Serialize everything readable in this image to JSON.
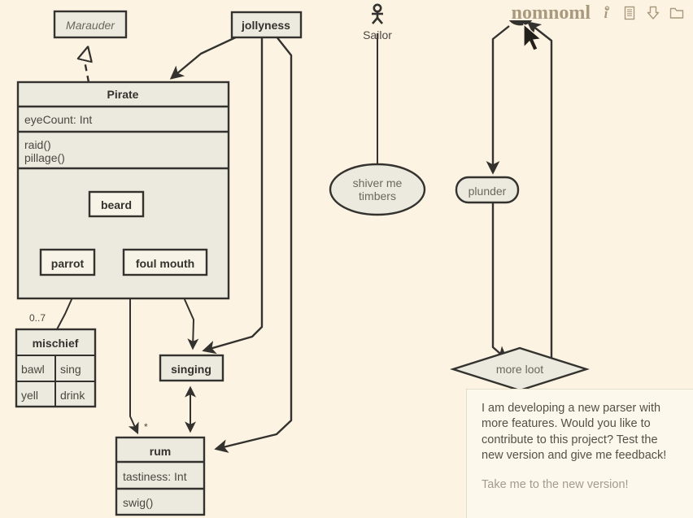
{
  "header": {
    "brand": "nomnoml",
    "icons": [
      {
        "name": "info-icon",
        "label": "i"
      },
      {
        "name": "document-icon",
        "label": "document"
      },
      {
        "name": "download-icon",
        "label": "download"
      },
      {
        "name": "open-folder-icon",
        "label": "open folder"
      }
    ]
  },
  "notice": {
    "message": "I am developing a new parser with more features. Would you like to contribute to this project? Test the new version and give me feedback!",
    "link": "Take me to the new version!"
  },
  "diagram": {
    "nodes": {
      "marauder": {
        "title": "Marauder",
        "style": "abstract"
      },
      "jollyness": {
        "title": "jollyness",
        "style": "class"
      },
      "pirate": {
        "title": "Pirate",
        "attributes": "eyeCount: Int",
        "methods_line1": "raid()",
        "methods_line2": "pillage()"
      },
      "beard": {
        "title": "beard"
      },
      "parrot": {
        "title": "parrot"
      },
      "foul_mouth": {
        "title": "foul mouth"
      },
      "mischief": {
        "title": "mischief",
        "rows": [
          [
            "bawl",
            "sing"
          ],
          [
            "yell",
            "drink"
          ]
        ]
      },
      "singing": {
        "title": "singing"
      },
      "rum": {
        "title": "rum",
        "attributes": "tastiness: Int",
        "methods": "swig()"
      },
      "sailor": {
        "title": "Sailor",
        "style": "actor"
      },
      "shiver": {
        "title_line1": "shiver me",
        "title_line2": "timbers",
        "style": "usecase"
      },
      "plunder": {
        "title": "plunder",
        "style": "start-end"
      },
      "more_loot": {
        "title": "more loot",
        "style": "choice"
      }
    },
    "edge_labels": {
      "mischief_multiplicity": "0..7",
      "rum_multiplicity": "*"
    }
  },
  "colors": {
    "background": "#fdf3e3",
    "node_fill": "#eceade",
    "stroke": "#33322e",
    "brand": "#a99a7e",
    "panel_bg": "#fdf8ec",
    "link": "#a39b8c"
  }
}
